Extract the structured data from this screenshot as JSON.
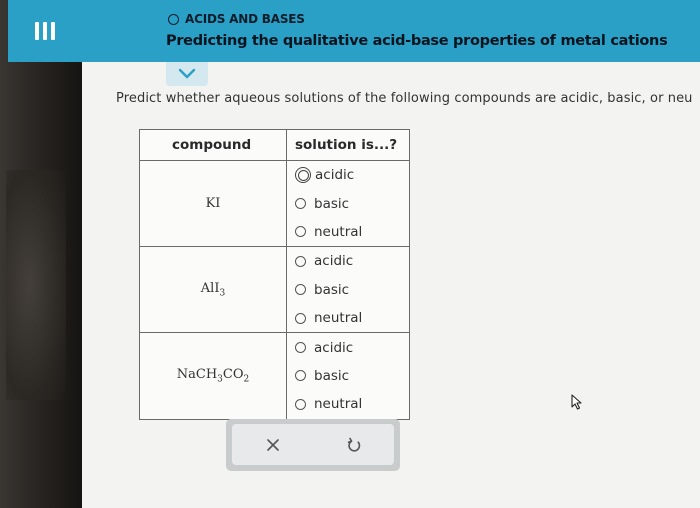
{
  "header": {
    "topic": "ACIDS AND BASES",
    "title": "Predicting the qualitative acid-base properties of metal cations"
  },
  "question": "Predict whether aqueous solutions of the following compounds are acidic, basic, or neu",
  "table": {
    "headers": {
      "compound": "compound",
      "solution": "solution is...?"
    },
    "rows": [
      {
        "compound": "KI",
        "options": [
          "acidic",
          "basic",
          "neutral"
        ],
        "selected": "acidic"
      },
      {
        "compound_main": "AlI",
        "compound_sub": "3",
        "options": [
          "acidic",
          "basic",
          "neutral"
        ],
        "selected": null
      },
      {
        "compound_parts": [
          "NaCH",
          "3",
          "CO",
          "2"
        ],
        "options": [
          "acidic",
          "basic",
          "neutral"
        ],
        "selected": null
      }
    ]
  },
  "icons": {
    "menu": "hamburger-menu-icon",
    "chevron": "chevron-down-icon",
    "clear": "close-icon",
    "undo": "undo-icon"
  },
  "colors": {
    "header_bg": "#2aa0c7",
    "chevron_tab_bg": "#d4e8f0",
    "screen_bg": "#f3f3f1",
    "chevron": "#2aa0c7"
  }
}
